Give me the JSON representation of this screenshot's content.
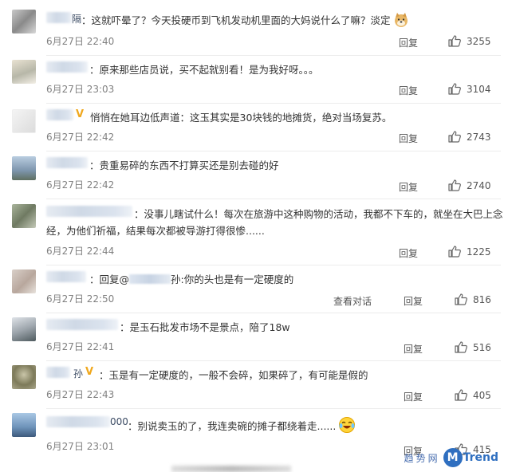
{
  "ui": {
    "reply_label": "回复",
    "view_conv_label": "查看对话",
    "verified_mark": "V"
  },
  "comments": [
    {
      "user_tail": "隔",
      "text": "：这就吓晕了？今天投硬币到飞机发动机里面的大妈说什么了嘛？淡定",
      "time": "6月27日 22:40",
      "likes": "3255"
    },
    {
      "user_tail": "",
      "text": "：原来那些店员说，买不起就别看！是为我好呀。。。",
      "time": "6月27日 23:03",
      "likes": "3104"
    },
    {
      "user_tail": "",
      "text": "悄悄在她耳边低声道：这玉其实是30块钱的地摊货，绝对当场复苏。",
      "time": "6月27日 22:42",
      "likes": "2743"
    },
    {
      "user_tail": "",
      "text": "：贵重易碎的东西不打算买还是别去碰的好",
      "time": "6月27日 22:42",
      "likes": "2740"
    },
    {
      "user_tail": "",
      "text": "：没事儿瞎试什么！每次在旅游中这种购物的活动，我都不下车的，就坐在大巴上念",
      "text2": "经，为他们祈福，结果每次都被导游打得很惨......",
      "time": "6月27日 22:44",
      "likes": "1225"
    },
    {
      "user_tail": "",
      "text_pre": "：回复@",
      "mention_tail": "孙",
      "text": ":你的头也是有一定硬度的",
      "time": "6月27日 22:50",
      "likes": "816"
    },
    {
      "user_tail": "",
      "text": "：是玉石批发市场不是景点，陪了18w",
      "time": "6月27日 22:41",
      "likes": "516"
    },
    {
      "user_tail": "孙",
      "text": "：玉是有一定硬度的，一般不会碎，如果碎了，有可能是假的",
      "time": "6月27日 22:43",
      "likes": "405"
    },
    {
      "user_tail": "000",
      "text": "：别说卖玉的了，我连卖碗的摊子都绕着走......",
      "time": "6月27日 23:01",
      "likes": "415"
    }
  ],
  "watermark": {
    "cn": "趋势网",
    "m": "M",
    "en": "Trend"
  },
  "colors": {
    "verified": "#f0a81e",
    "timestamp": "#808080",
    "accent": "#2f6fc0"
  }
}
